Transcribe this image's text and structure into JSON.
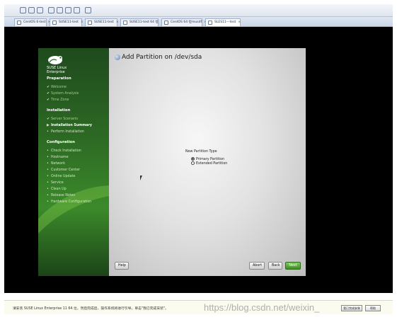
{
  "host": {
    "tabs": [
      {
        "label": "CentOS 6-test",
        "active": false
      },
      {
        "label": "SUSE11-test",
        "active": false
      },
      {
        "label": "SUSE11-test",
        "active": false
      },
      {
        "label": "SUSE11-test 64 位",
        "active": false
      },
      {
        "label": "CentOS 64 位musdf",
        "active": false
      },
      {
        "label": "SLES11---test",
        "active": true
      }
    ],
    "tab_close": "×",
    "status_text": "请安装 SUSE Linux Enterprise 11 64 位，然后完成后，操作系统将进行引导，单击\"我已完成安装\"。",
    "watermark": "https://blog.csdn.net/weixin_",
    "status_buttons": [
      "我已完成安装",
      "帮助"
    ]
  },
  "installer": {
    "brand_line1": "SUSE Linux",
    "brand_line2": "Enterprise",
    "sections": [
      {
        "title": "Preparation",
        "items": [
          {
            "label": "Welcome",
            "state": "done"
          },
          {
            "label": "System Analysis",
            "state": "done"
          },
          {
            "label": "Time Zone",
            "state": "done"
          }
        ]
      },
      {
        "title": "Installation",
        "items": [
          {
            "label": "Server Scenario",
            "state": "done"
          },
          {
            "label": "Installation Summary",
            "state": "current"
          },
          {
            "label": "Perform Installation",
            "state": "pending"
          }
        ]
      },
      {
        "title": "Configuration",
        "items": [
          {
            "label": "Check Installation",
            "state": "pending"
          },
          {
            "label": "Hostname",
            "state": "pending"
          },
          {
            "label": "Network",
            "state": "pending"
          },
          {
            "label": "Customer Center",
            "state": "pending"
          },
          {
            "label": "Online Update",
            "state": "pending"
          },
          {
            "label": "Service",
            "state": "pending"
          },
          {
            "label": "Clean Up",
            "state": "pending"
          },
          {
            "label": "Release Notes",
            "state": "pending"
          },
          {
            "label": "Hardware Configuration",
            "state": "pending"
          }
        ]
      }
    ],
    "page_title": "Add Partition on /dev/sda",
    "partition_type_label": "New Partition Type",
    "options": [
      {
        "label": "Primary Partition",
        "selected": true
      },
      {
        "label": "Extended Partition",
        "selected": false
      }
    ],
    "buttons": {
      "help": "Help",
      "abort": "Abort",
      "back": "Back",
      "next": "Next"
    }
  }
}
